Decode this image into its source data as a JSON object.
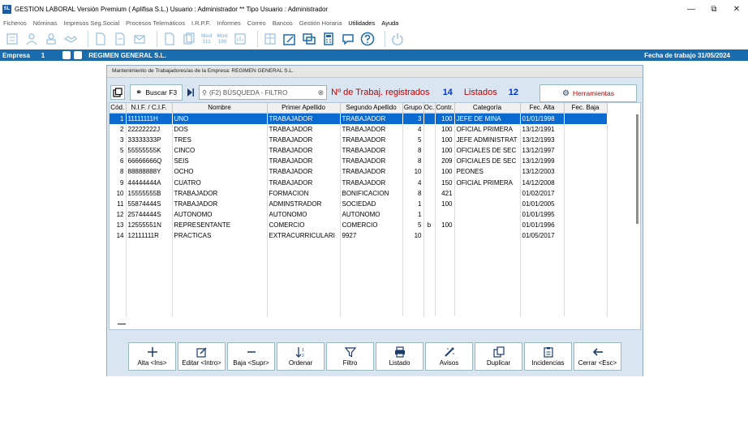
{
  "window": {
    "app_icon": "SL",
    "title": "GESTION LABORAL Versión Premium ( Aplifisa S.L.)    Usuario : Administrador  **  Tipo Usuario : Administrador",
    "minimize": "—",
    "restore": "⧉",
    "close": "✕"
  },
  "menu": [
    "Ficheros",
    "Nóminas",
    "Impresos Seg.Social",
    "Procesos Telemáticos",
    "I.R.P.F.",
    "Informes",
    "Correo",
    "Bancos",
    "Gestión Horaria",
    "Utilidades",
    "Ayuda"
  ],
  "toolbar": {
    "mod1": [
      "Mod",
      "111"
    ],
    "mod2": [
      "Mod",
      "190"
    ]
  },
  "empresa_bar": {
    "label": "Empresa",
    "number": "1",
    "name": "REGIMEN GENERAL S.L.",
    "fecha": "Fecha de trabajo  31/05/2024"
  },
  "dialog": {
    "title": "Mantenimiento de Trabajadores/as de la Empresa: REGIMEN GENERAL S.L.",
    "buscar_label": "Buscar F3",
    "search_placeholder": "(F2) BÚSQUEDA - FILTRO",
    "registrados_label": "Nº de Trabaj. registrados",
    "registrados_count": "14",
    "listados_label": "Listados",
    "listados_count": "12",
    "herramientas_label": "Herramientas"
  },
  "table": {
    "columns": [
      "Cód.",
      "N.I.F. / C.I.F.",
      "Nombre",
      "Primer Apellido",
      "Segundo Apellido",
      "Grupo",
      "Oc.",
      "Contr.",
      "Categoría",
      "Fec. Alta",
      "Fec. Baja"
    ],
    "rows": [
      [
        "1",
        "11111111H",
        "UNO",
        "TRABAJADOR",
        "TRABAJADOR",
        "3",
        "",
        "100",
        "JEFE DE MINA",
        "01/01/1998",
        ""
      ],
      [
        "2",
        "22222222J",
        "DOS",
        "TRABAJADOR",
        "TRABAJADOR",
        "4",
        "",
        "100",
        "OFICIAL PRIMERA",
        "13/12/1991",
        ""
      ],
      [
        "3",
        "33333333P",
        "TRES",
        "TRABAJADOR",
        "TRABAJADOR",
        "5",
        "",
        "100",
        "JEFE ADMINISTRAT",
        "13/12/1993",
        ""
      ],
      [
        "5",
        "55555555K",
        "CINCO",
        "TRABAJADOR",
        "TRABAJADOR",
        "8",
        "",
        "100",
        "OFICIALES DE SEC",
        "13/12/1997",
        ""
      ],
      [
        "6",
        "66666666Q",
        "SEIS",
        "TRABAJADOR",
        "TRABAJADOR",
        "8",
        "",
        "209",
        "OFICIALES DE SEC",
        "13/12/1999",
        ""
      ],
      [
        "8",
        "88888888Y",
        "OCHO",
        "TRABAJADOR",
        "TRABAJADOR",
        "10",
        "",
        "100",
        "PEONES",
        "13/12/2003",
        ""
      ],
      [
        "9",
        "44444444A",
        "CUATRO",
        "TRABAJADOR",
        "TRABAJADOR",
        "4",
        "",
        "150",
        "OFICIAL PRIMERA",
        "14/12/2008",
        ""
      ],
      [
        "10",
        "15555555B",
        "TRABAJADOR",
        "FORMACION",
        "BONIFICACION",
        "8",
        "",
        "421",
        "",
        "01/02/2017",
        ""
      ],
      [
        "11",
        "55874444S",
        "TRABAJADOR",
        "ADMINSTRADOR",
        "SOCIEDAD",
        "1",
        "",
        "100",
        "",
        "01/01/2005",
        ""
      ],
      [
        "12",
        "25744444S",
        "AUTONOMO",
        "AUTONOMO",
        "AUTONOMO",
        "1",
        "",
        "",
        "",
        "01/01/1995",
        ""
      ],
      [
        "13",
        "12555551N",
        "REPRESENTANTE",
        "COMERCIO",
        "COMERCIO",
        "5",
        "b",
        "100",
        "",
        "01/01/1996",
        ""
      ],
      [
        "14",
        "12111111R",
        "PRACTICAS",
        "EXTRACURRICULARI",
        "9927",
        "10",
        "",
        "",
        "",
        "01/05/2017",
        ""
      ]
    ]
  },
  "buttons": [
    {
      "label": "Alta <Ins>",
      "icon": "plus-icon"
    },
    {
      "label": "Editar <Intro>",
      "icon": "edit-icon"
    },
    {
      "label": "Baja <Supr>",
      "icon": "minus-icon"
    },
    {
      "label": "Ordenar",
      "icon": "sort-icon"
    },
    {
      "label": "Filtro",
      "icon": "filter-icon"
    },
    {
      "label": "Listado",
      "icon": "print-icon"
    },
    {
      "label": "Avisos",
      "icon": "alert-icon"
    },
    {
      "label": "Duplicar",
      "icon": "duplicate-icon"
    },
    {
      "label": "Incidencias",
      "icon": "clipboard-icon"
    },
    {
      "label": "Cerrar <Esc>",
      "icon": "arrow-left-icon"
    }
  ],
  "colors": {
    "accent": "#1b6cad",
    "selection": "#0a6ad0",
    "red_label": "#c00000",
    "blue_count": "#0033cc"
  }
}
